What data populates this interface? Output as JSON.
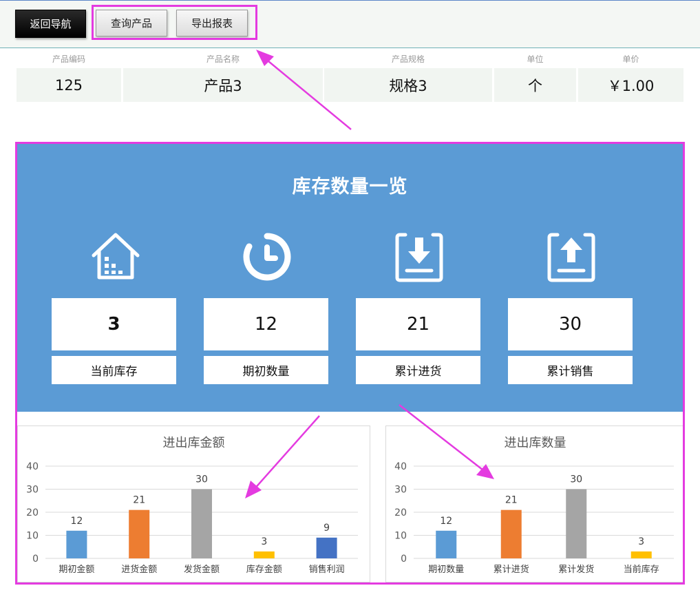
{
  "toolbar": {
    "back_label": "返回导航",
    "query_label": "查询产品",
    "export_label": "导出报表"
  },
  "product_info": {
    "headers": [
      "产品编码",
      "产品名称",
      "产品规格",
      "单位",
      "单价"
    ],
    "values": [
      "125",
      "产品3",
      "规格3",
      "个",
      "￥1.00"
    ]
  },
  "inventory": {
    "title": "库存数量一览",
    "stats": [
      {
        "icon": "warehouse-icon",
        "value": "3",
        "label": "当前库存"
      },
      {
        "icon": "clock-icon",
        "value": "12",
        "label": "期初数量"
      },
      {
        "icon": "download-box-icon",
        "value": "21",
        "label": "累计进货"
      },
      {
        "icon": "upload-box-icon",
        "value": "30",
        "label": "累计销售"
      }
    ]
  },
  "colors": {
    "panel_blue": "#5b9bd5",
    "highlight_magenta": "#e43be0",
    "bar_blue": "#5b9bd5",
    "bar_orange": "#ed7d31",
    "bar_gray": "#a5a5a5",
    "bar_yellow": "#ffc000",
    "bar_darkblue": "#4472c4"
  },
  "chart_data": [
    {
      "type": "bar",
      "title": "进出库金额",
      "categories": [
        "期初金额",
        "进货金额",
        "发货金额",
        "库存金额",
        "销售利润"
      ],
      "values": [
        12,
        21,
        30,
        3,
        9
      ],
      "colors": [
        "#5b9bd5",
        "#ed7d31",
        "#a5a5a5",
        "#ffc000",
        "#4472c4"
      ],
      "ylim": [
        0,
        40
      ],
      "yticks": [
        0,
        10,
        20,
        30,
        40
      ],
      "grid": true,
      "data_labels": true
    },
    {
      "type": "bar",
      "title": "进出库数量",
      "categories": [
        "期初数量",
        "累计进货",
        "累计发货",
        "当前库存"
      ],
      "values": [
        12,
        21,
        30,
        3
      ],
      "colors": [
        "#5b9bd5",
        "#ed7d31",
        "#a5a5a5",
        "#ffc000"
      ],
      "ylim": [
        0,
        40
      ],
      "yticks": [
        0,
        10,
        20,
        30,
        40
      ],
      "grid": true,
      "data_labels": true
    }
  ]
}
